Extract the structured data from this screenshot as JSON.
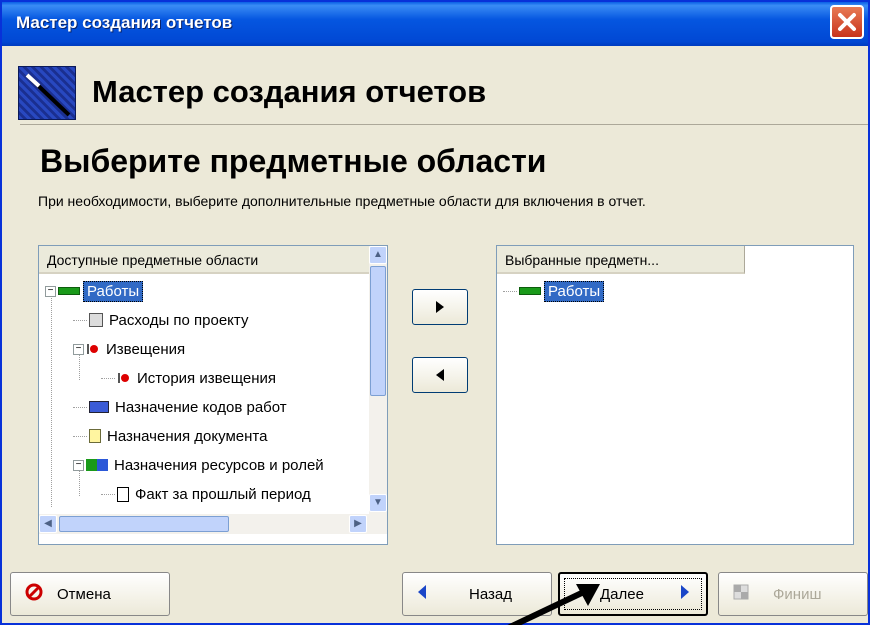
{
  "window": {
    "title": "Мастер создания отчетов"
  },
  "header": {
    "title": "Мастер создания отчетов"
  },
  "page": {
    "title": "Выберите предметные области",
    "description": "При необходимости, выберите дополнительные предметные области для включения в отчет."
  },
  "available": {
    "header": "Доступные предметные области",
    "items": [
      {
        "label": "Работы",
        "icon": "green-bar-icon",
        "level": 0,
        "expander": "minus",
        "selected": true
      },
      {
        "label": "Расходы по проекту",
        "icon": "calculator-icon",
        "level": 1,
        "expander": "",
        "selected": false
      },
      {
        "label": "Извещения",
        "icon": "red-flag-icon",
        "level": 1,
        "expander": "minus",
        "selected": false
      },
      {
        "label": "История извещения",
        "icon": "red-flag-icon",
        "level": 2,
        "expander": "",
        "selected": false
      },
      {
        "label": "Назначение кодов работ",
        "icon": "code-card-icon",
        "level": 1,
        "expander": "",
        "selected": false
      },
      {
        "label": "Назначения документа",
        "icon": "document-icon",
        "level": 1,
        "expander": "",
        "selected": false
      },
      {
        "label": "Назначения ресурсов и ролей",
        "icon": "resources-icon",
        "level": 1,
        "expander": "minus",
        "selected": false
      },
      {
        "label": "Факт за прошлый период",
        "icon": "page-icon",
        "level": 2,
        "expander": "",
        "selected": false
      }
    ]
  },
  "selected": {
    "header": "Выбранные предметн...",
    "items": [
      {
        "label": "Работы",
        "icon": "green-bar-icon"
      }
    ]
  },
  "buttons": {
    "add": "add-arrow-icon",
    "remove": "remove-arrow-icon",
    "cancel": "Отмена",
    "back": "Назад",
    "next": "Далее",
    "finish": "Финиш"
  }
}
